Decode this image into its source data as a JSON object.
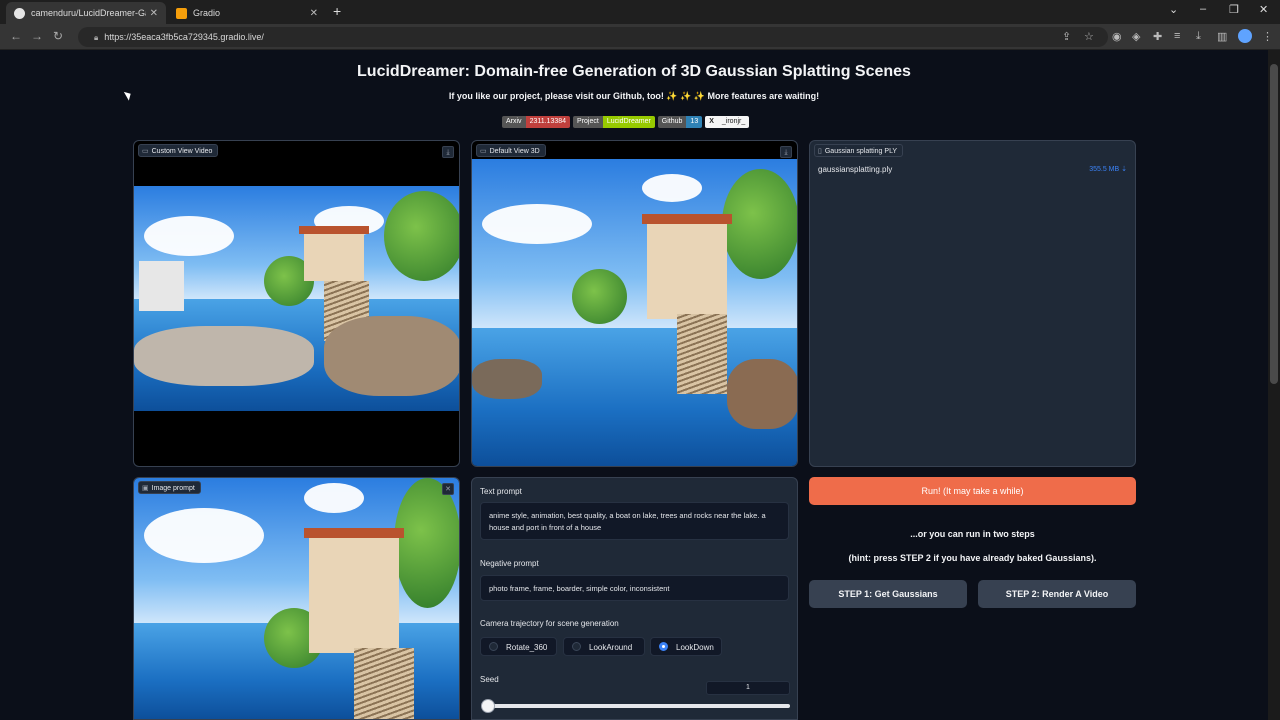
{
  "browser": {
    "tabs": [
      {
        "label": "camenduru/LucidDreamer-Gau",
        "icon": "github-icon"
      },
      {
        "label": "Gradio",
        "icon": "gradio-icon"
      }
    ],
    "url": "https://35eaca3fb5ca729345.gradio.live/"
  },
  "header": {
    "title": "LucidDreamer: Domain-free Generation of 3D Gaussian Splatting Scenes",
    "subtitle": "If you like our project, please visit our Github, too! ✨ ✨ ✨ More features are waiting!"
  },
  "badges": [
    {
      "left": "Arxiv",
      "right": "2311.13384",
      "color": "#c0403d"
    },
    {
      "left": "Project",
      "right": "LucidDreamer",
      "color": "#97ca00"
    },
    {
      "left": "Github",
      "right": "13",
      "color": "#2f82b5"
    },
    {
      "left": "X",
      "right": "_ironjr_",
      "color": "#f5f5f5"
    }
  ],
  "panels": {
    "custom_video": {
      "label": "Custom View Video"
    },
    "default_3d": {
      "label": "Default View 3D"
    },
    "gaussian_ply": {
      "label": "Gaussian splatting PLY",
      "file_name": "gaussiansplatting.ply",
      "file_size": "355.5 MB ⇣"
    },
    "image_prompt": {
      "label": "Image prompt"
    }
  },
  "form": {
    "text_prompt_label": "Text prompt",
    "text_prompt_value": "anime style, animation, best quality, a boat on lake, trees and rocks near the lake. a house and port in front of a house",
    "negative_prompt_label": "Negative prompt",
    "negative_prompt_value": "photo frame, frame, boarder, simple color, inconsistent",
    "trajectory_label": "Camera trajectory for scene generation",
    "trajectory_options": [
      "Rotate_360",
      "LookAround",
      "LookDown"
    ],
    "trajectory_selected": "LookDown",
    "seed_label": "Seed",
    "seed_value": "1",
    "seed_slider_fraction": 0.0
  },
  "actions": {
    "run_label": "Run! (It may take a while)",
    "or_text": "...or you can run in two steps",
    "hint_text": "(hint: press STEP 2 if you have already baked Gaussians).",
    "step1_label": "STEP 1: Get Gaussians",
    "step2_label": "STEP 2: Render A Video"
  },
  "colors": {
    "accent": "#ef6c4a",
    "background": "#0b0f19",
    "panel": "#1f2937",
    "link": "#3b82f6"
  }
}
